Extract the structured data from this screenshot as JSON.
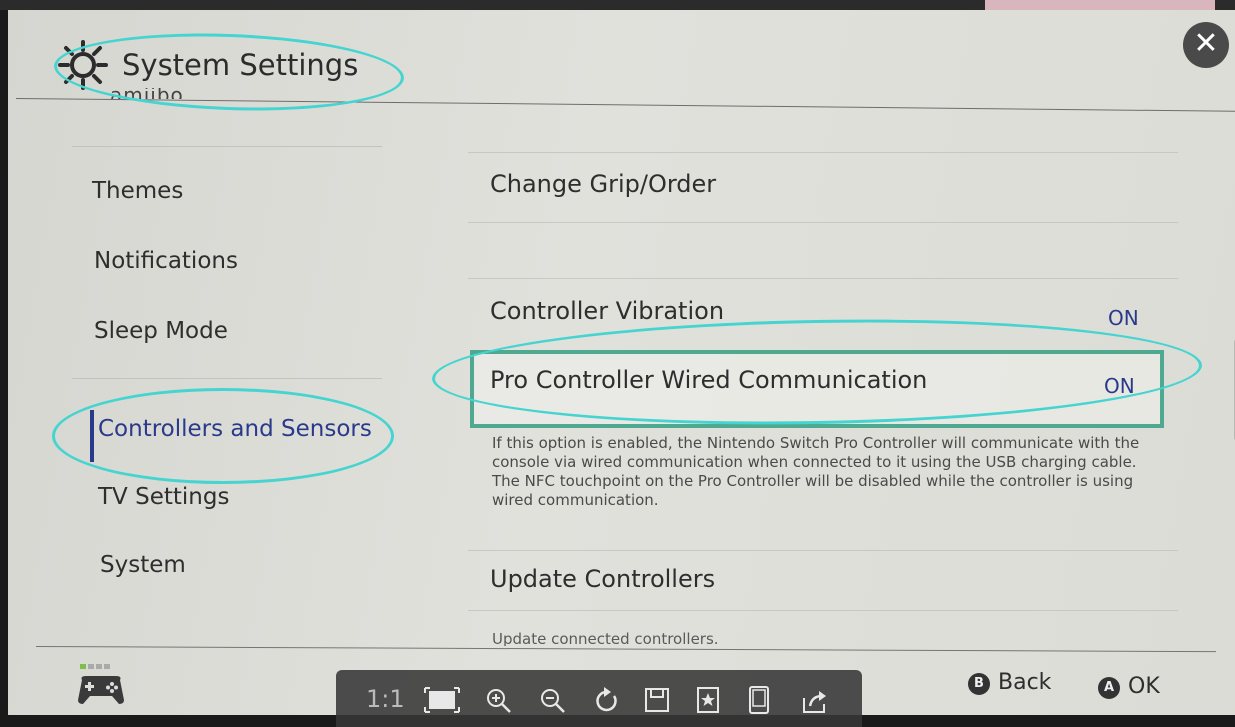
{
  "header": {
    "title": "System Settings",
    "partial_item": "amiibo"
  },
  "sidebar": {
    "items": [
      {
        "label": "Themes"
      },
      {
        "label": "Notifications"
      },
      {
        "label": "Sleep Mode"
      },
      {
        "label": "Controllers and Sensors",
        "active": true
      },
      {
        "label": "TV Settings"
      },
      {
        "label": "System"
      }
    ]
  },
  "main": {
    "rows": [
      {
        "label": "Change Grip/Order",
        "value": ""
      },
      {
        "label": "Controller Vibration",
        "value": "ON"
      },
      {
        "label": "Pro Controller Wired Communication",
        "value": "ON",
        "selected": true
      },
      {
        "label": "Update Controllers",
        "value": ""
      }
    ],
    "description": "If this option is enabled, the Nintendo Switch Pro Controller will communicate with the console via wired communication when connected to it using the USB charging cable. The NFC touchpoint on the Pro Controller will be disabled while the controller is using wired communication.",
    "update_sub": "Update connected controllers."
  },
  "footer": {
    "back_button": "B",
    "back_label": "Back",
    "ok_button": "A",
    "ok_label": "OK"
  },
  "viewer_toolbar": {
    "zoom_ratio": "1:1",
    "icons": [
      "fit-screen-icon",
      "zoom-in-icon",
      "zoom-out-icon",
      "rotate-icon",
      "save-icon",
      "favorite-icon",
      "device-icon",
      "share-icon"
    ]
  },
  "colors": {
    "accent_text": "#2a3a8a",
    "selection_border": "#4fa890",
    "annotation": "#45d4d0"
  }
}
